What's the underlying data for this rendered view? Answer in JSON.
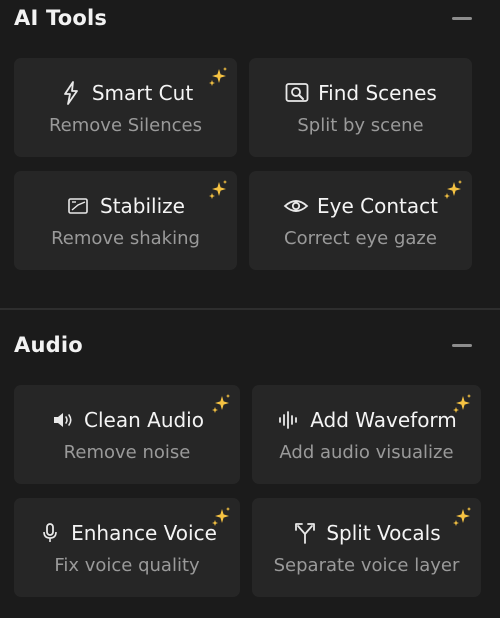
{
  "sections": [
    {
      "title": "AI Tools",
      "cards": [
        {
          "title": "Smart Cut",
          "subtitle": "Remove Silences",
          "icon": "lightning-icon",
          "ai": true
        },
        {
          "title": "Find Scenes",
          "subtitle": "Split by scene",
          "icon": "scene-search-icon",
          "ai": false
        },
        {
          "title": "Stabilize",
          "subtitle": "Remove shaking",
          "icon": "stabilize-icon",
          "ai": true
        },
        {
          "title": "Eye Contact",
          "subtitle": "Correct eye gaze",
          "icon": "eye-icon",
          "ai": true
        }
      ]
    },
    {
      "title": "Audio",
      "cards": [
        {
          "title": "Clean Audio",
          "subtitle": "Remove noise",
          "icon": "speaker-icon",
          "ai": true
        },
        {
          "title": "Add Waveform",
          "subtitle": "Add audio visualize",
          "icon": "waveform-icon",
          "ai": true
        },
        {
          "title": "Enhance Voice",
          "subtitle": "Fix voice quality",
          "icon": "microphone-icon",
          "ai": true
        },
        {
          "title": "Split Vocals",
          "subtitle": "Separate voice layer",
          "icon": "split-arrows-icon",
          "ai": true
        }
      ]
    }
  ],
  "colors": {
    "background": "#1b1b1b",
    "card": "#262626",
    "title": "#f4f4f4",
    "subtitle": "#9a9a9a",
    "sparkle": "#f5c242"
  }
}
